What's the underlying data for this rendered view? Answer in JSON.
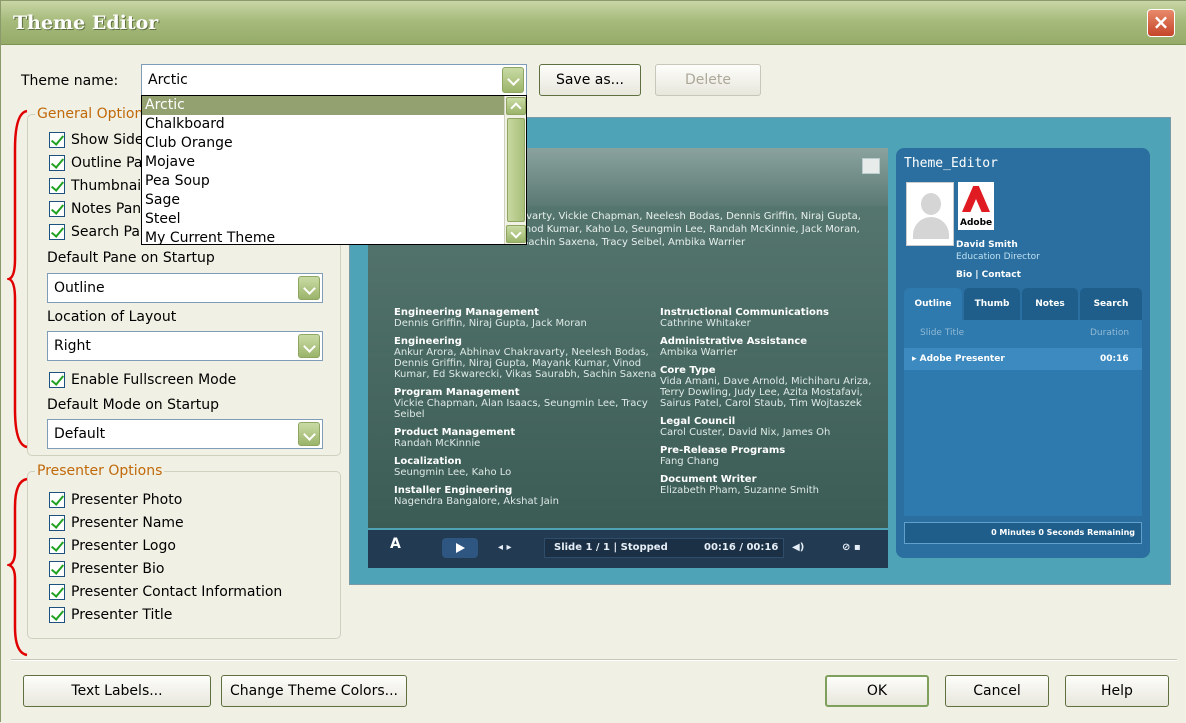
{
  "window": {
    "title": "Theme Editor",
    "close_label": "×"
  },
  "theme_name": {
    "label": "Theme name:",
    "value": "Arctic",
    "save_as_label": "Save as...",
    "delete_label": "Delete",
    "options": [
      "Arctic",
      "Chalkboard",
      "Club Orange",
      "Mojave",
      "Pea Soup",
      "Sage",
      "Steel",
      "My Current Theme"
    ]
  },
  "general_options": {
    "legend": "General Option",
    "checkboxes": [
      "Show Side",
      "Outline Pa",
      "Thumbnail",
      "Notes Pan",
      "Search Pa"
    ],
    "default_pane_label": "Default Pane on Startup",
    "default_pane_value": "Outline",
    "location_label": "Location of Layout",
    "location_value": "Right",
    "fullscreen_label": "Enable Fullscreen Mode",
    "default_mode_label": "Default Mode on Startup",
    "default_mode_value": "Default"
  },
  "presenter_options": {
    "legend": "Presenter Options",
    "checkboxes": [
      "Presenter Photo",
      "Presenter Name",
      "Presenter Logo",
      "Presenter Bio",
      "Presenter Contact Information",
      "Presenter Title"
    ]
  },
  "preview": {
    "credits_top": "rvarty, Vickie Chapman, Neelesh Bodas, Dennis Griffin, Niraj Gupta, inod Kumar, Kaho Lo, Seungmin Lee, Randah McKinnie, Jack Moran, Sachin Saxena, Tracy Seibel, Ambika Warrier",
    "left_col": [
      {
        "h": "Engineering Management",
        "t": "Dennis Griffin, Niraj Gupta, Jack Moran"
      },
      {
        "h": "Engineering",
        "t": "Ankur Arora, Abhinav Chakravarty, Neelesh Bodas, Dennis Griffin, Niraj Gupta, Mayank Kumar, Vinod Kumar, Ed Skwarecki, Vikas Saurabh, Sachin Saxena"
      },
      {
        "h": "Program Management",
        "t": "Vickie Chapman, Alan Isaacs, Seungmin Lee, Tracy Seibel"
      },
      {
        "h": "Product Management",
        "t": "Randah McKinnie"
      },
      {
        "h": "Localization",
        "t": "Seungmin Lee, Kaho Lo"
      },
      {
        "h": "Installer Engineering",
        "t": "Nagendra Bangalore, Akshat Jain"
      }
    ],
    "right_col": [
      {
        "h": "Instructional Communications",
        "t": "Cathrine Whitaker"
      },
      {
        "h": "Administrative Assistance",
        "t": "Ambika Warrier"
      },
      {
        "h": "Core Type",
        "t": "Vida Amani, Dave Arnold, Michiharu Ariza, Terry Dowling, Judy Lee, Azita Mostafavi, Sairus Patel, Carol Staub, Tim Wojtaszek"
      },
      {
        "h": "Legal Council",
        "t": "Carol Custer, David Nix, James Oh"
      },
      {
        "h": "Pre-Release Programs",
        "t": "Fang Chang"
      },
      {
        "h": "Document Writer",
        "t": "Elizabeth Pham, Suzanne Smith"
      }
    ],
    "slide_status": "Slide 1 / 1 | Stopped",
    "time": "00:16 / 00:16",
    "side_title": "Theme_Editor",
    "adobe_word": "Adobe",
    "presenter_name": "David Smith",
    "presenter_role": "Education Director",
    "links": "Bio | Contact",
    "tabs": [
      "Outline",
      "Thumb",
      "Notes",
      "Search"
    ],
    "col_slide_title": "Slide Title",
    "col_duration": "Duration",
    "row_title": "▸ Adobe Presenter",
    "row_duration": "00:16",
    "remaining": "0 Minutes 0 Seconds Remaining"
  },
  "footer": {
    "text_labels": "Text Labels...",
    "change_colors": "Change Theme Colors...",
    "ok": "OK",
    "cancel": "Cancel",
    "help": "Help"
  }
}
